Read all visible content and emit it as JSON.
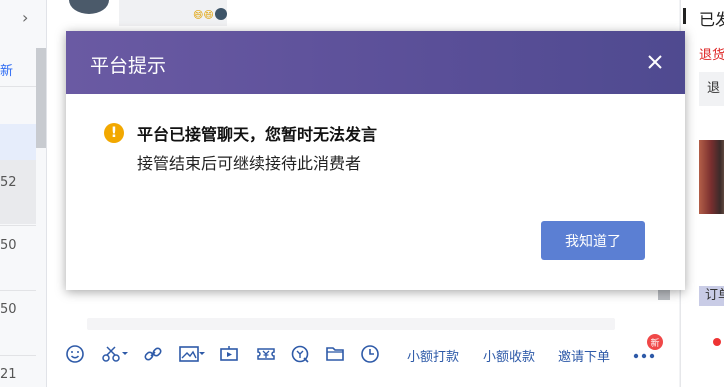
{
  "left_list": {
    "chevron": "›",
    "link_text": "新",
    "rows": [
      "52",
      "50",
      "50",
      "21"
    ]
  },
  "chat": {
    "emojis": "😄😄"
  },
  "toolbar": {
    "icons": [
      "smile-icon",
      "scissors-icon",
      "link-icon",
      "image-icon",
      "video-icon",
      "coupon-icon",
      "service-icon",
      "folder-icon",
      "clock-icon",
      "more-icon"
    ],
    "small_pay": "小额打款",
    "small_collect": "小额收款",
    "invite_order": "邀请下单",
    "badge": "新"
  },
  "right_panel": {
    "title": "已发",
    "refund_label": "退货",
    "refund_box": "退",
    "order_tag": "订单"
  },
  "modal": {
    "title": "平台提示",
    "message_main": "平台已接管聊天，您暂时无法发言",
    "message_sub": "接管结束后可继续接待此消费者",
    "ok_label": "我知道了",
    "warning_glyph": "!"
  },
  "colors": {
    "header_gradient_start": "#6a5aa3",
    "header_gradient_end": "#4f4a90",
    "ok_button": "#5b7fd3",
    "warning": "#f2a800",
    "toolbar_icon": "#2e5aa8"
  }
}
